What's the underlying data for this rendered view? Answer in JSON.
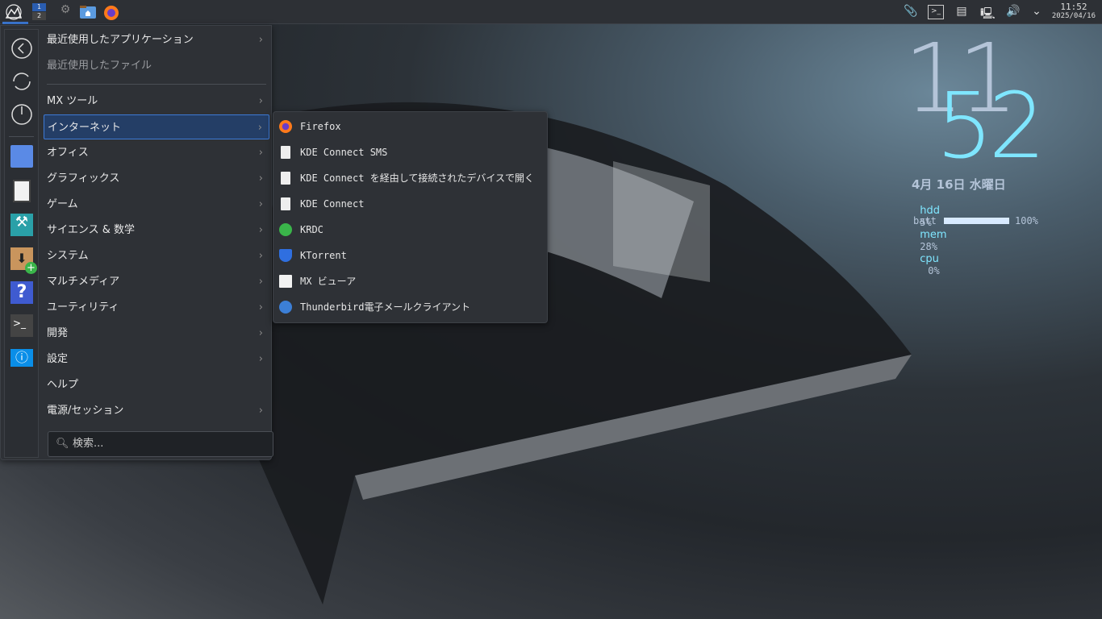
{
  "taskbar": {
    "pager": [
      "1",
      "2"
    ],
    "clock_time": "11:52",
    "clock_date": "2025/04/16"
  },
  "menu": {
    "items": [
      {
        "label": "最近使用したアプリケーション",
        "submenu": true
      },
      {
        "label": "最近使用したファイル",
        "submenu": false,
        "dim": true
      },
      {
        "label": "MX ツール",
        "submenu": true
      },
      {
        "label": "インターネット",
        "submenu": true,
        "selected": true
      },
      {
        "label": "オフィス",
        "submenu": true
      },
      {
        "label": "グラフィックス",
        "submenu": true
      },
      {
        "label": "ゲーム",
        "submenu": true
      },
      {
        "label": "サイエンス & 数学",
        "submenu": true
      },
      {
        "label": "システム",
        "submenu": true
      },
      {
        "label": "マルチメディア",
        "submenu": true
      },
      {
        "label": "ユーティリティ",
        "submenu": true
      },
      {
        "label": "開発",
        "submenu": true
      },
      {
        "label": "設定",
        "submenu": true
      },
      {
        "label": "ヘルプ",
        "submenu": false
      },
      {
        "label": "電源/セッション",
        "submenu": true
      }
    ],
    "search_placeholder": "検索..."
  },
  "submenu": {
    "items": [
      {
        "label": "Firefox",
        "icon": "firefox"
      },
      {
        "label": "KDE Connect SMS",
        "icon": "kdeconnect"
      },
      {
        "label": "KDE Connect を経由して接続されたデバイスで開く",
        "icon": "kdeconnect"
      },
      {
        "label": "KDE Connect",
        "icon": "kdeconnect"
      },
      {
        "label": "KRDC",
        "icon": "krdc"
      },
      {
        "label": "KTorrent",
        "icon": "ktorrent"
      },
      {
        "label": "MX ビューア",
        "icon": "mx-viewer"
      },
      {
        "label": "Thunderbird電子メールクライアント",
        "icon": "thunderbird"
      }
    ]
  },
  "conky": {
    "hour": "11",
    "minute": "52",
    "date": "4月 16日 水曜日",
    "hdd_label": "hdd",
    "hdd": "5%",
    "mem_label": "mem",
    "mem": "28%",
    "cpu_label": "cpu",
    "cpu": "0%",
    "batt_label": "batt",
    "batt": "100%",
    "batt_fraction": 1.0
  },
  "colors": {
    "accent": "#3d7ad6",
    "conky_cyan": "#7fe6ff",
    "conky_gray": "#b4c4d8"
  }
}
